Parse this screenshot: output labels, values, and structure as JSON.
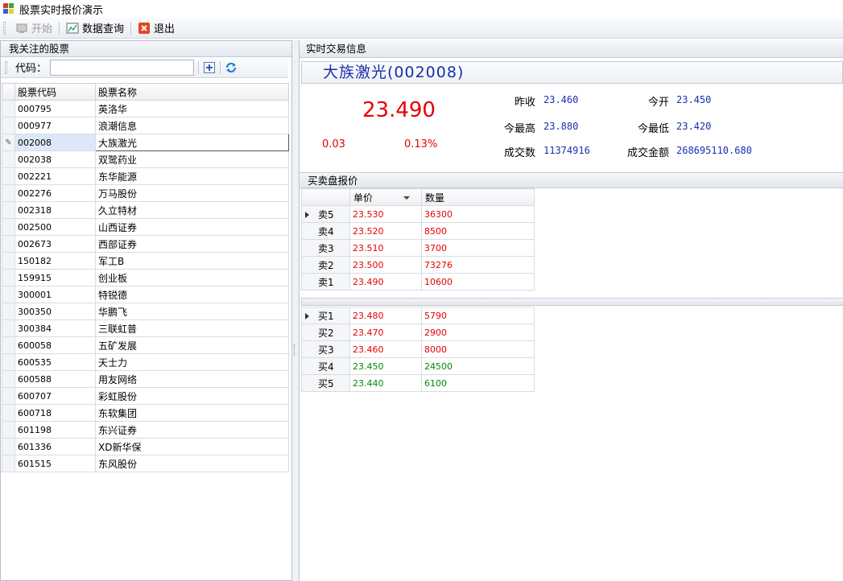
{
  "window": {
    "title": "股票实时报价演示"
  },
  "toolbar": {
    "start_label": "开始",
    "query_label": "数据查询",
    "exit_label": "退出"
  },
  "left_panel": {
    "title": "我关注的股票",
    "code_label": "代码：",
    "code_input_value": "",
    "columns": [
      "股票代码",
      "股票名称"
    ],
    "selected_code": "002008",
    "rows": [
      {
        "code": "000795",
        "name": "英洛华"
      },
      {
        "code": "000977",
        "name": "浪潮信息"
      },
      {
        "code": "002008",
        "name": "大族激光"
      },
      {
        "code": "002038",
        "name": "双鹭药业"
      },
      {
        "code": "002221",
        "name": "东华能源"
      },
      {
        "code": "002276",
        "name": "万马股份"
      },
      {
        "code": "002318",
        "name": "久立特材"
      },
      {
        "code": "002500",
        "name": "山西证券"
      },
      {
        "code": "002673",
        "name": "西部证券"
      },
      {
        "code": "150182",
        "name": "军工B"
      },
      {
        "code": "159915",
        "name": "创业板"
      },
      {
        "code": "300001",
        "name": "特锐德"
      },
      {
        "code": "300350",
        "name": "华鹏飞"
      },
      {
        "code": "300384",
        "name": "三联虹普"
      },
      {
        "code": "600058",
        "name": "五矿发展"
      },
      {
        "code": "600535",
        "name": "天士力"
      },
      {
        "code": "600588",
        "name": "用友网络"
      },
      {
        "code": "600707",
        "name": "彩虹股份"
      },
      {
        "code": "600718",
        "name": "东软集团"
      },
      {
        "code": "601198",
        "name": "东兴证券"
      },
      {
        "code": "601336",
        "name": "XD新华保"
      },
      {
        "code": "601515",
        "name": "东风股份"
      }
    ]
  },
  "right_panel": {
    "title": "实时交易信息",
    "stock_title": "大族激光(002008)",
    "price": "23.490",
    "change": "0.03",
    "change_pct": "0.13%",
    "stats": {
      "prev_close_label": "昨收",
      "prev_close": "23.460",
      "open_label": "今开",
      "open": "23.450",
      "high_label": "今最高",
      "high": "23.880",
      "low_label": "今最低",
      "low": "23.420",
      "volume_label": "成交数",
      "volume": "11374916",
      "amount_label": "成交金额",
      "amount": "268695110.680"
    },
    "quote_title": "买卖盘报价",
    "quote_columns": [
      "单价",
      "数量"
    ],
    "sell": [
      {
        "label": "卖5",
        "price": "23.530",
        "qty": "36300",
        "color": "red"
      },
      {
        "label": "卖4",
        "price": "23.520",
        "qty": "8500",
        "color": "red"
      },
      {
        "label": "卖3",
        "price": "23.510",
        "qty": "3700",
        "color": "red"
      },
      {
        "label": "卖2",
        "price": "23.500",
        "qty": "73276",
        "color": "red"
      },
      {
        "label": "卖1",
        "price": "23.490",
        "qty": "10600",
        "color": "red"
      }
    ],
    "buy": [
      {
        "label": "买1",
        "price": "23.480",
        "qty": "5790",
        "color": "red"
      },
      {
        "label": "买2",
        "price": "23.470",
        "qty": "2900",
        "color": "red"
      },
      {
        "label": "买3",
        "price": "23.460",
        "qty": "8000",
        "color": "red"
      },
      {
        "label": "买4",
        "price": "23.450",
        "qty": "24500",
        "color": "green"
      },
      {
        "label": "买5",
        "price": "23.440",
        "qty": "6100",
        "color": "green"
      }
    ]
  },
  "colors": {
    "up": "#e60000",
    "down": "#008a00",
    "value_blue": "#1a2fb0"
  }
}
